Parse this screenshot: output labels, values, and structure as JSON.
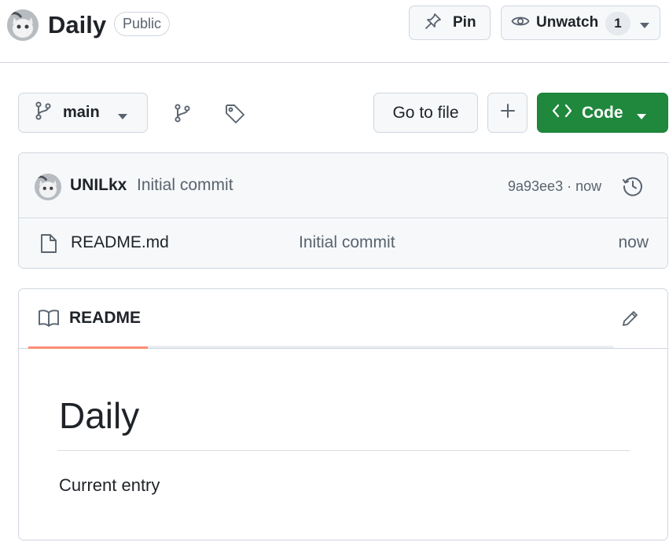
{
  "header": {
    "repo_name": "Daily",
    "visibility": "Public",
    "pin_label": "Pin",
    "watch_label": "Unwatch",
    "watch_count": "1",
    "icons": [
      "avatar",
      "pin-icon",
      "eye-icon",
      "chevron-down-icon"
    ]
  },
  "toolbar": {
    "branch": "main",
    "goto_file": "Go to file",
    "add_symbol": "+",
    "code_label": "Code",
    "icons": [
      "git-branch-icon",
      "tag-icon",
      "code-brackets-icon"
    ]
  },
  "commit": {
    "author": "UNILkx",
    "message": "Initial commit",
    "meta": "9a93ee3 · now"
  },
  "files": [
    {
      "name": "README.md",
      "commit": "Initial commit",
      "time": "now"
    }
  ],
  "readme": {
    "tab_label": "README",
    "heading": "Daily",
    "body": "Current entry"
  },
  "colors": {
    "accent_green": "#1f883d",
    "tab_underline": "#fd8c73",
    "border": "#d0d7de",
    "muted_text": "#59636e"
  }
}
